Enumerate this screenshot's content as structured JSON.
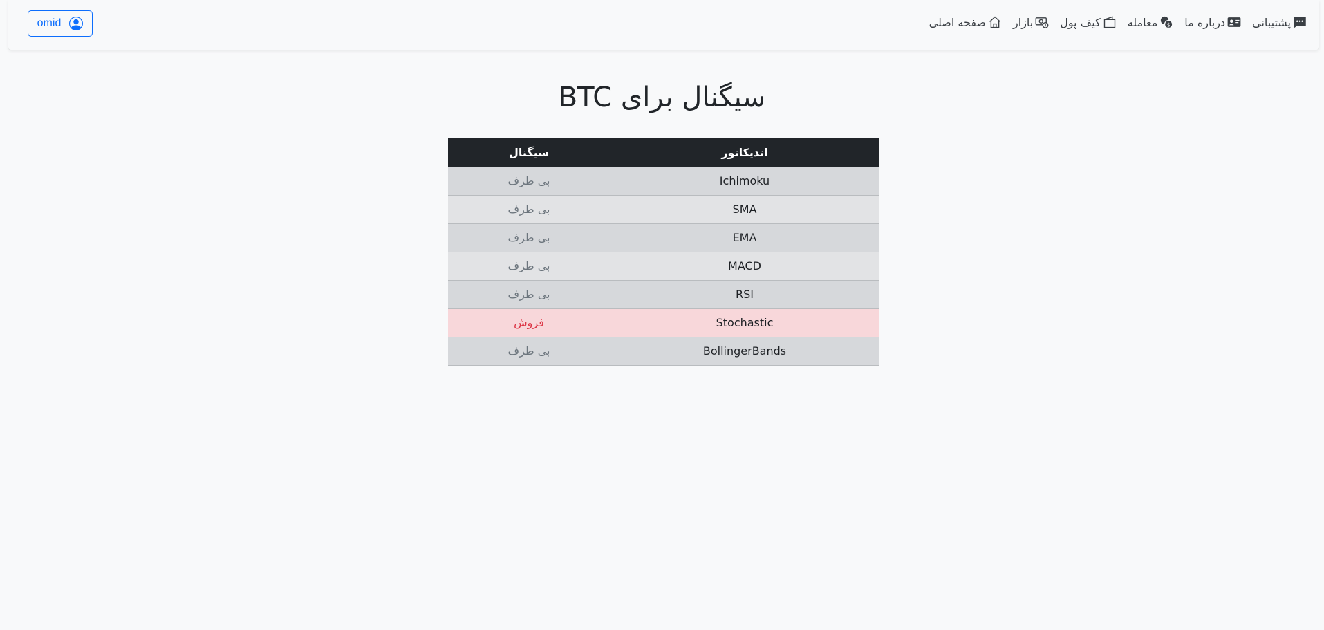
{
  "header": {
    "user_label": "omid",
    "nav": [
      {
        "label": "صفحه اصلی",
        "icon": "house-icon"
      },
      {
        "label": "بازار",
        "icon": "cash-coin-icon"
      },
      {
        "label": "کیف پول",
        "icon": "wallet-icon"
      },
      {
        "label": "معامله",
        "icon": "coins-icon"
      },
      {
        "label": "درباره ما",
        "icon": "person-vcard-icon"
      },
      {
        "label": "پشتیبانی",
        "icon": "chat-dots-icon"
      }
    ]
  },
  "main": {
    "title": "سیگنال برای BTC",
    "table": {
      "headers": {
        "indicator": "اندیکاتور",
        "signal": "سیگنال"
      },
      "rows": [
        {
          "indicator": "Ichimoku",
          "signal": "بی طرف",
          "status": "neutral"
        },
        {
          "indicator": "SMA",
          "signal": "بی طرف",
          "status": "neutral"
        },
        {
          "indicator": "EMA",
          "signal": "بی طرف",
          "status": "neutral"
        },
        {
          "indicator": "MACD",
          "signal": "بی طرف",
          "status": "neutral"
        },
        {
          "indicator": "RSI",
          "signal": "بی طرف",
          "status": "neutral"
        },
        {
          "indicator": "Stochastic",
          "signal": "فروش",
          "status": "sell"
        },
        {
          "indicator": "BollingerBands",
          "signal": "بی طرف",
          "status": "neutral"
        }
      ]
    }
  },
  "colors": {
    "accent": "#0d6efd",
    "header_bg": "#212529",
    "neutral_text": "#6c757d",
    "sell_text": "#dc3545",
    "sell_row_bg": "#f8d7da"
  }
}
